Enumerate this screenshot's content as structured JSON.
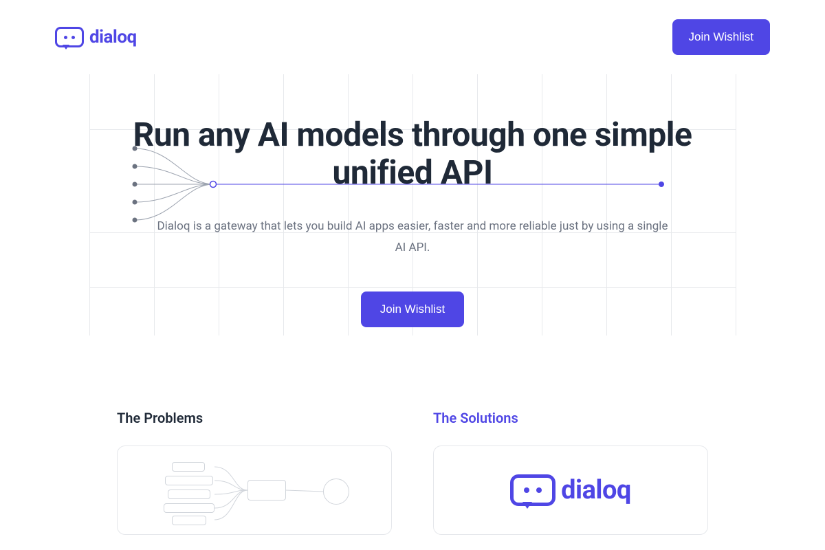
{
  "brand": {
    "name": "dialoq"
  },
  "header": {
    "cta_label": "Join Wishlist"
  },
  "hero": {
    "title": "Run any AI models through one simple unified API",
    "subtitle": "Dialoq is a gateway that lets you build AI apps easier, faster and more reliable just by using a single AI API.",
    "cta_label": "Join Wishlist"
  },
  "sections": {
    "problems_title": "The Problems",
    "solutions_title": "The Solutions"
  },
  "colors": {
    "primary": "#4f46e5"
  }
}
